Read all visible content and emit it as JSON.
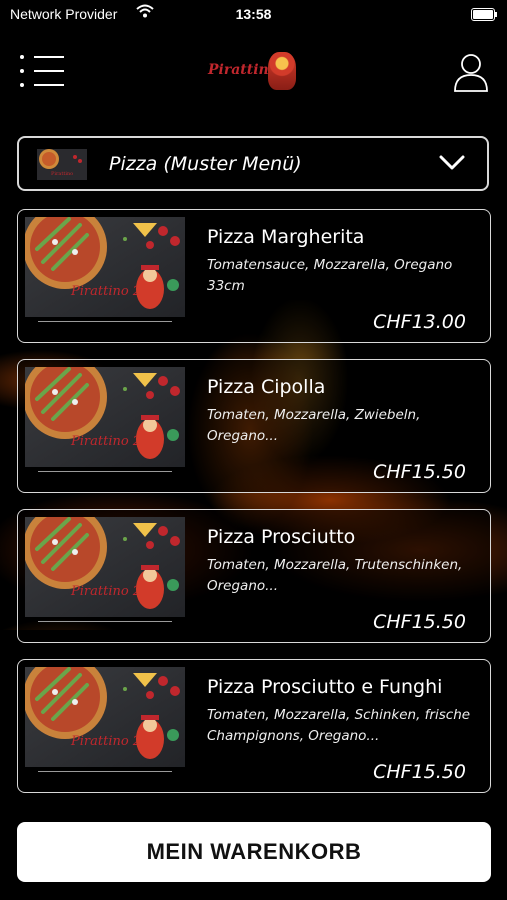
{
  "status_bar": {
    "carrier": "Network Provider",
    "time": "13:58"
  },
  "header": {
    "logo_text": "Pirattino 2"
  },
  "category": {
    "label": "Pizza (Muster Menü)"
  },
  "items": [
    {
      "name": "Pizza Margherita",
      "description": "Tomatensauce, Mozzarella, Oregano 33cm",
      "price": "CHF13.00"
    },
    {
      "name": "Pizza Cipolla",
      "description": "Tomaten, Mozzarella, Zwiebeln, Oregano...",
      "price": "CHF15.50"
    },
    {
      "name": "Pizza Prosciutto",
      "description": "Tomaten, Mozzarella, Trutenschinken, Oregano...",
      "price": "CHF15.50"
    },
    {
      "name": "Pizza Prosciutto e Funghi",
      "description": "Tomaten, Mozzarella, Schinken, frische Champignons, Oregano...",
      "price": "CHF15.50"
    }
  ],
  "cart_button": {
    "label": "MEIN WARENKORB"
  },
  "colors": {
    "background": "#000000",
    "border": "#d8d8d8",
    "brand_red": "#c0272d"
  },
  "icons": [
    "wifi-icon",
    "battery-icon",
    "hamburger-menu-icon",
    "user-icon",
    "chevron-down-icon"
  ]
}
